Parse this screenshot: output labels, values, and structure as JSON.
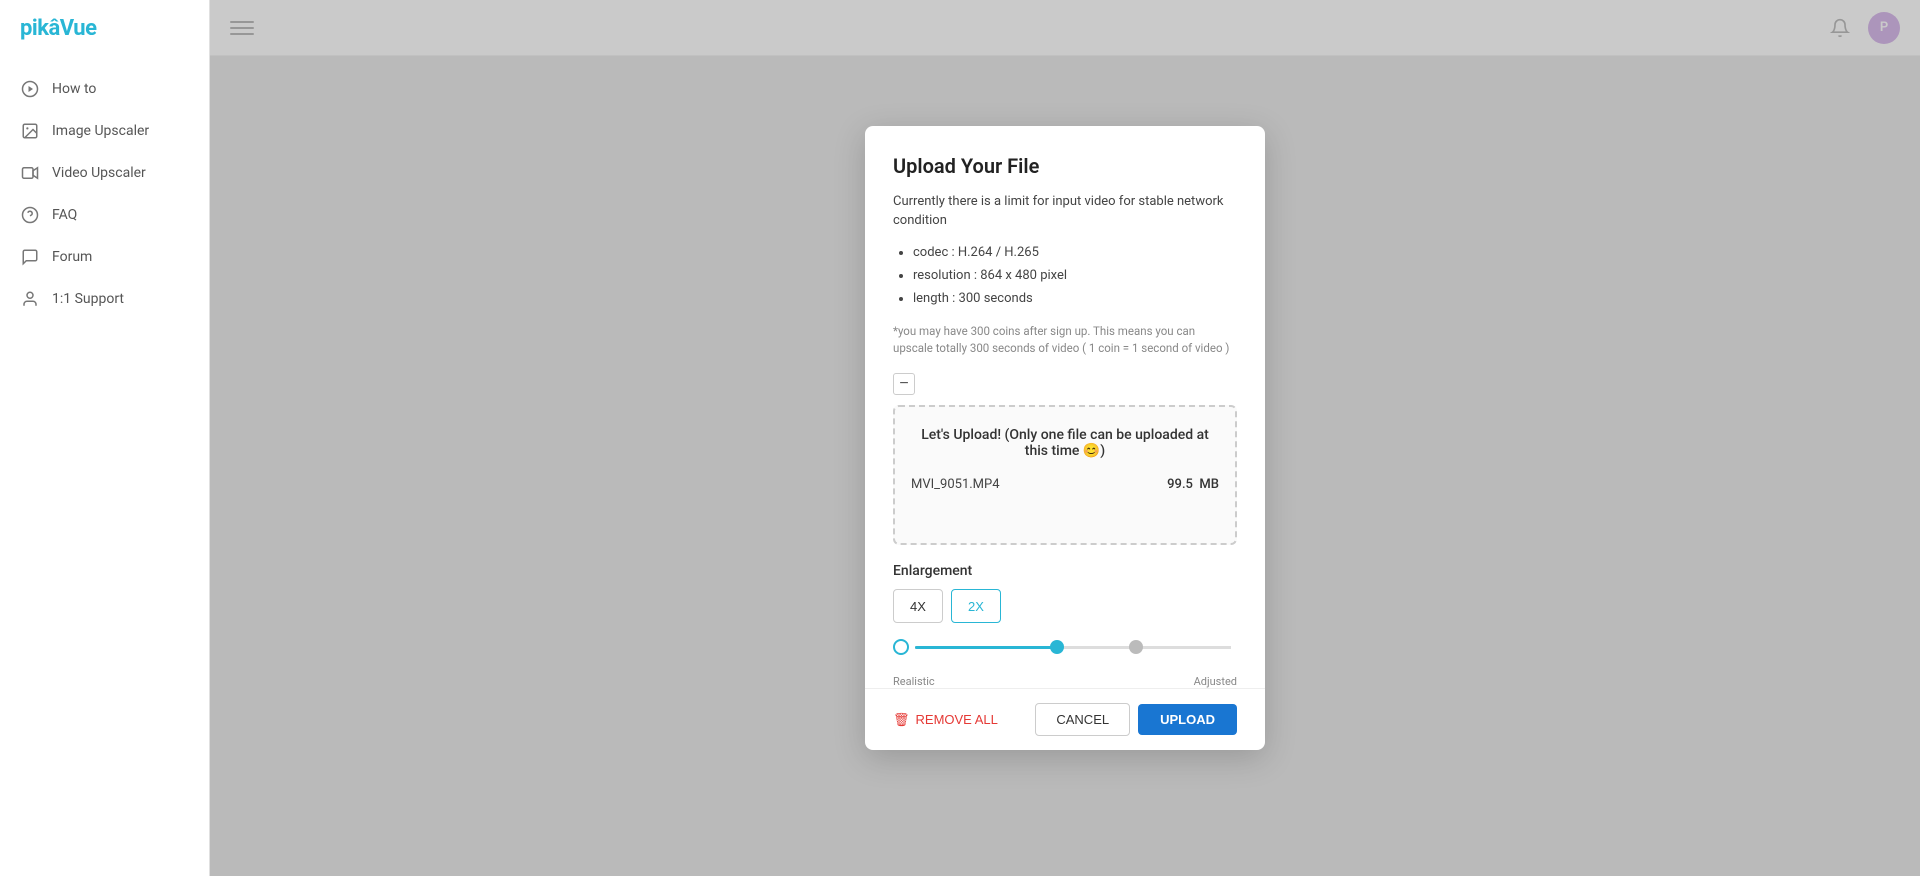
{
  "app": {
    "logo": "pikâVue",
    "avatar_initial": "P"
  },
  "sidebar": {
    "items": [
      {
        "id": "how-to",
        "label": "How to",
        "icon": "play-circle"
      },
      {
        "id": "image-upscaler",
        "label": "Image Upscaler",
        "icon": "image"
      },
      {
        "id": "video-upscaler",
        "label": "Video Upscaler",
        "icon": "video"
      },
      {
        "id": "faq",
        "label": "FAQ",
        "icon": "help-circle"
      },
      {
        "id": "forum",
        "label": "Forum",
        "icon": "message-square"
      },
      {
        "id": "support",
        "label": "1:1 Support",
        "icon": "user"
      }
    ]
  },
  "modal": {
    "title": "Upload Your File",
    "description": "Currently there is a limit for input video for stable network condition",
    "limits": [
      "codec : H.264 / H.265",
      "resolution : 864 x 480 pixel",
      "length : 300 seconds"
    ],
    "note": "*you may have 300 coins after sign up. This means you can upscale totally 300 seconds of video ( 1 coin = 1 second of video )",
    "upload_zone": {
      "title": "Let's Upload! (Only one file can be uploaded at this time 😊)",
      "file_name": "MVI_9051.MP4",
      "file_size": "99.5",
      "file_size_unit": "MB"
    },
    "enlargement": {
      "label": "Enlargement",
      "options": [
        {
          "id": "4x",
          "label": "4X",
          "active": false
        },
        {
          "id": "2x",
          "label": "2X",
          "active": true
        }
      ]
    },
    "slider": {
      "left_label": "Realistic",
      "right_label": "Adjusted"
    },
    "footer": {
      "remove_all": "REMOVE ALL",
      "cancel": "CANCEL",
      "upload": "UPLOAD"
    }
  }
}
